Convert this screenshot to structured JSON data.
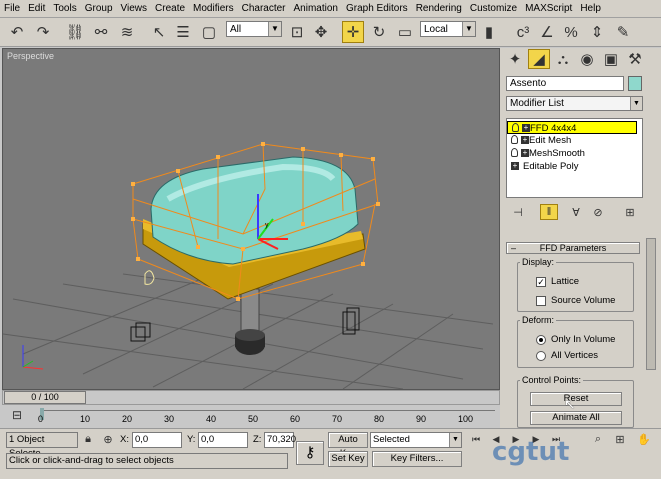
{
  "menu": [
    "File",
    "Edit",
    "Tools",
    "Group",
    "Views",
    "Create",
    "Modifiers",
    "Character",
    "Animation",
    "Graph Editors",
    "Rendering",
    "Customize",
    "MAXScript",
    "Help"
  ],
  "toolbar": {
    "selection_filter": "All",
    "ref_coord": "Local"
  },
  "viewport": {
    "label": "Perspective"
  },
  "panel": {
    "object_name": "Assento",
    "object_color": "#8fd8cc",
    "modifier_list": "Modifier List",
    "stack": [
      {
        "label": "FFD 4x4x4",
        "selected": true,
        "has_bulb": true
      },
      {
        "label": "Edit Mesh",
        "selected": false,
        "has_bulb": true
      },
      {
        "label": "MeshSmooth",
        "selected": false,
        "has_bulb": true
      },
      {
        "label": "Editable Poly",
        "selected": false,
        "has_bulb": false
      }
    ],
    "rollout_title": "FFD Parameters",
    "display_group": "Display:",
    "lattice_label": "Lattice",
    "source_volume_label": "Source Volume",
    "deform_group": "Deform:",
    "only_in_volume_label": "Only In Volume",
    "all_vertices_label": "All Vertices",
    "control_points_group": "Control Points:",
    "reset_label": "Reset",
    "animate_all_label": "Animate All"
  },
  "timeline": {
    "frame": "0 / 100",
    "ticks": [
      "0",
      "10",
      "20",
      "30",
      "40",
      "50",
      "60",
      "70",
      "80",
      "90",
      "100"
    ]
  },
  "status": {
    "selection": "1 Object Selecte",
    "x_label": "X:",
    "x_value": "0,0",
    "y_label": "Y:",
    "y_value": "0,0",
    "z_label": "Z:",
    "z_value": "70,320",
    "prompt": "Click or click-and-drag to select objects",
    "auto_key": "Auto Key",
    "key_mode": "Selected",
    "set_key": "Set Key",
    "key_filters": "Key Filters..."
  },
  "watermark": "cgtut"
}
